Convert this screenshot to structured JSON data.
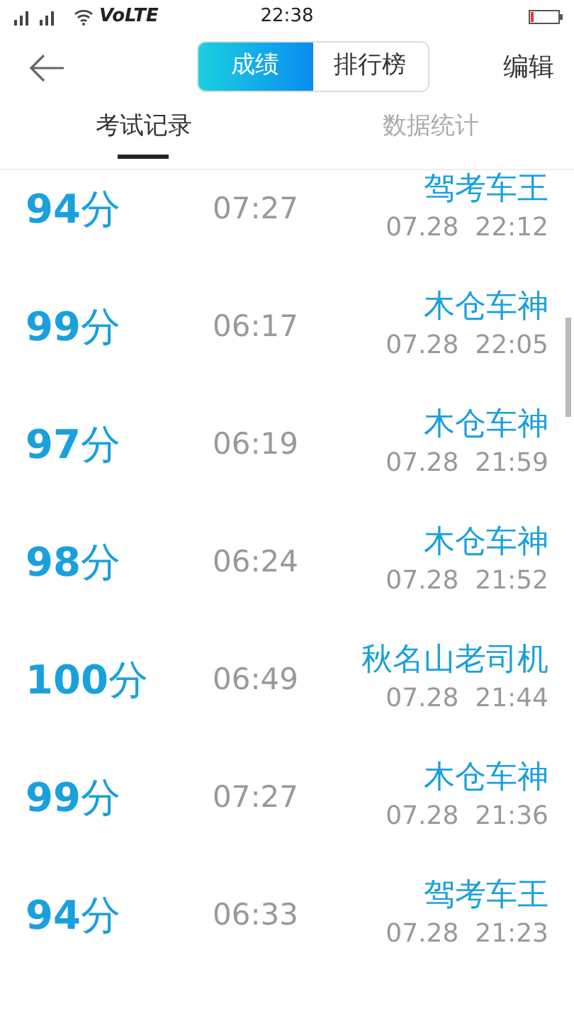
{
  "status_bar": {
    "network": "VoLTE",
    "time": "22:38"
  },
  "header": {
    "segments": [
      {
        "label": "成绩",
        "selected": true
      },
      {
        "label": "排行榜",
        "selected": false
      }
    ],
    "action": "编辑"
  },
  "tabs": [
    {
      "label": "考试记录",
      "selected": true
    },
    {
      "label": "数据统计",
      "selected": false
    }
  ],
  "records": [
    {
      "score": "**94**分",
      "duration": "07:27",
      "name": "驾考车王",
      "date": "07.28  22:12"
    },
    {
      "score": "**99**分",
      "duration": "06:17",
      "name": "木仓车神",
      "date": "07.28  22:05"
    },
    {
      "score": "**97**分",
      "duration": "06:19",
      "name": "木仓车神",
      "date": "07.28  21:59"
    },
    {
      "score": "**98**分",
      "duration": "06:24",
      "name": "木仓车神",
      "date": "07.28  21:52"
    },
    {
      "score": "**100**分",
      "duration": "06:49",
      "name": "秋名山老司机",
      "date": "07.28  21:44"
    },
    {
      "score": "**99**分",
      "duration": "07:27",
      "name": "木仓车神",
      "date": "07.28  21:36"
    },
    {
      "score": "**94**分",
      "duration": "06:33",
      "name": "驾考车王",
      "date": "07.28  21:23"
    }
  ]
}
